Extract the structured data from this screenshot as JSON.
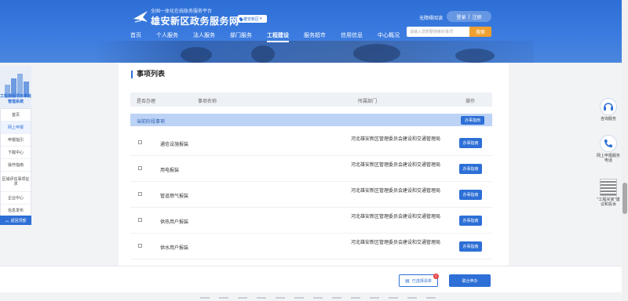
{
  "header": {
    "subtitle": "全国一体化在线政务服务平台",
    "title": "雄安新区政务服务网",
    "region": "雄安新区",
    "accessibility_link": "无障碍阅读",
    "login": "登录",
    "register": "注册",
    "search_placeholder": "请输入您想要搜索的事项",
    "search_button": "搜索",
    "nav": [
      "首页",
      "个人服务",
      "法人服务",
      "部门服务",
      "工程建设",
      "服务超市",
      "信用信息",
      "中心概况"
    ],
    "active_nav": "工程建设"
  },
  "sidebar": {
    "title": "工程建设项目审批管理系统",
    "items": [
      "首页",
      "网上申报",
      "申报指引",
      "下载中心",
      "操作指南",
      "区域评估事项征求",
      "企业中心",
      "信息发布"
    ],
    "active_item": "网上申报",
    "back": "返回顶部"
  },
  "main": {
    "section_title": "事项列表",
    "columns": [
      "是否办理",
      "事项名称",
      "所属部门",
      "操作"
    ],
    "stage_label": "当前阶段事项",
    "stage_button": "办事指南",
    "rows": [
      {
        "name": "通信设施报装",
        "dept": "河北雄安新区管理委员会建设和交通管理局",
        "action": "办事指南"
      },
      {
        "name": "用电报装",
        "dept": "河北雄安新区管理委员会建设和交通管理局",
        "action": "办事指南"
      },
      {
        "name": "管道燃气报装",
        "dept": "河北雄安新区管理委员会建设和交通管理局",
        "action": "办事指南"
      },
      {
        "name": "供热用户报装",
        "dept": "河北雄安新区管理委员会建设和交通管理局",
        "action": "办事指南"
      },
      {
        "name": "供水用户报装",
        "dept": "河北雄安新区管理委员会建设和交通管理局",
        "action": "办事指南"
      }
    ]
  },
  "bottom": {
    "selected_button": "已选择清单",
    "selected_count": "0",
    "merge_button": "联合申办"
  },
  "floats": {
    "consult": "咨询服务",
    "online_phone": "网上申报服务电话",
    "qrcode": "\"工程买家\"建议和投诉"
  }
}
